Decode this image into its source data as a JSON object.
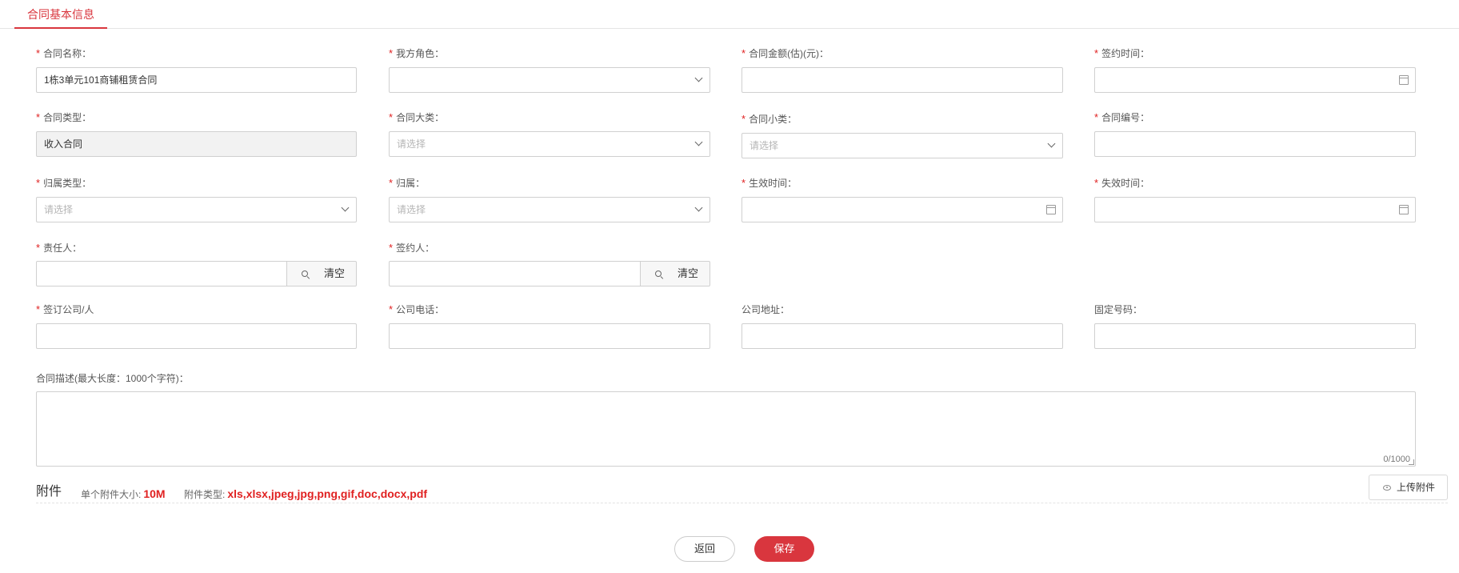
{
  "tabs": {
    "active": "合同基本信息"
  },
  "form": {
    "contract_name": {
      "label": "合同名称：",
      "required": true,
      "value": "1栋3单元101商铺租赁合同"
    },
    "our_role": {
      "label": "我方角色：",
      "required": true,
      "value": ""
    },
    "contract_amount": {
      "label": "合同金额(估)(元)：",
      "required": true,
      "value": ""
    },
    "sign_time": {
      "label": "签约时间：",
      "required": true,
      "value": ""
    },
    "contract_type": {
      "label": "合同类型：",
      "required": true,
      "value": "收入合同"
    },
    "major_category": {
      "label": "合同大类：",
      "required": true,
      "placeholder": "请选择"
    },
    "minor_category": {
      "label": "合同小类：",
      "required": true,
      "placeholder": "请选择"
    },
    "contract_number": {
      "label": "合同编号：",
      "required": true,
      "value": ""
    },
    "ownership_type": {
      "label": "归属类型：",
      "required": true,
      "placeholder": "请选择"
    },
    "ownership": {
      "label": "归属：",
      "required": true,
      "placeholder": "请选择"
    },
    "effective_time": {
      "label": "生效时间：",
      "required": true,
      "value": ""
    },
    "expiry_time": {
      "label": "失效时间：",
      "required": true,
      "value": ""
    },
    "responsible_person": {
      "label": "责任人：",
      "required": true,
      "value": "",
      "clear_label": "清空"
    },
    "signer": {
      "label": "签约人：",
      "required": true,
      "value": "",
      "clear_label": "清空"
    },
    "signing_company": {
      "label": "签订公司/人",
      "required": true,
      "value": ""
    },
    "company_phone": {
      "label": "公司电话：",
      "required": true,
      "value": ""
    },
    "company_address": {
      "label": "公司地址：",
      "required": false,
      "value": ""
    },
    "landline": {
      "label": "固定号码：",
      "required": false,
      "value": ""
    },
    "description": {
      "label": "合同描述(最大长度：1000个字符)：",
      "value": "",
      "counter": "0/1000"
    }
  },
  "attachments": {
    "title": "附件",
    "size_label": "单个附件大小:",
    "size_value": "10M",
    "type_label": "附件类型:",
    "type_value": "xls,xlsx,jpeg,jpg,png,gif,doc,docx,pdf",
    "upload_label": "上传附件"
  },
  "actions": {
    "back": "返回",
    "save": "保存"
  },
  "colors": {
    "accent": "#d9363e",
    "required": "#e02020",
    "border": "#d0d0d0"
  }
}
